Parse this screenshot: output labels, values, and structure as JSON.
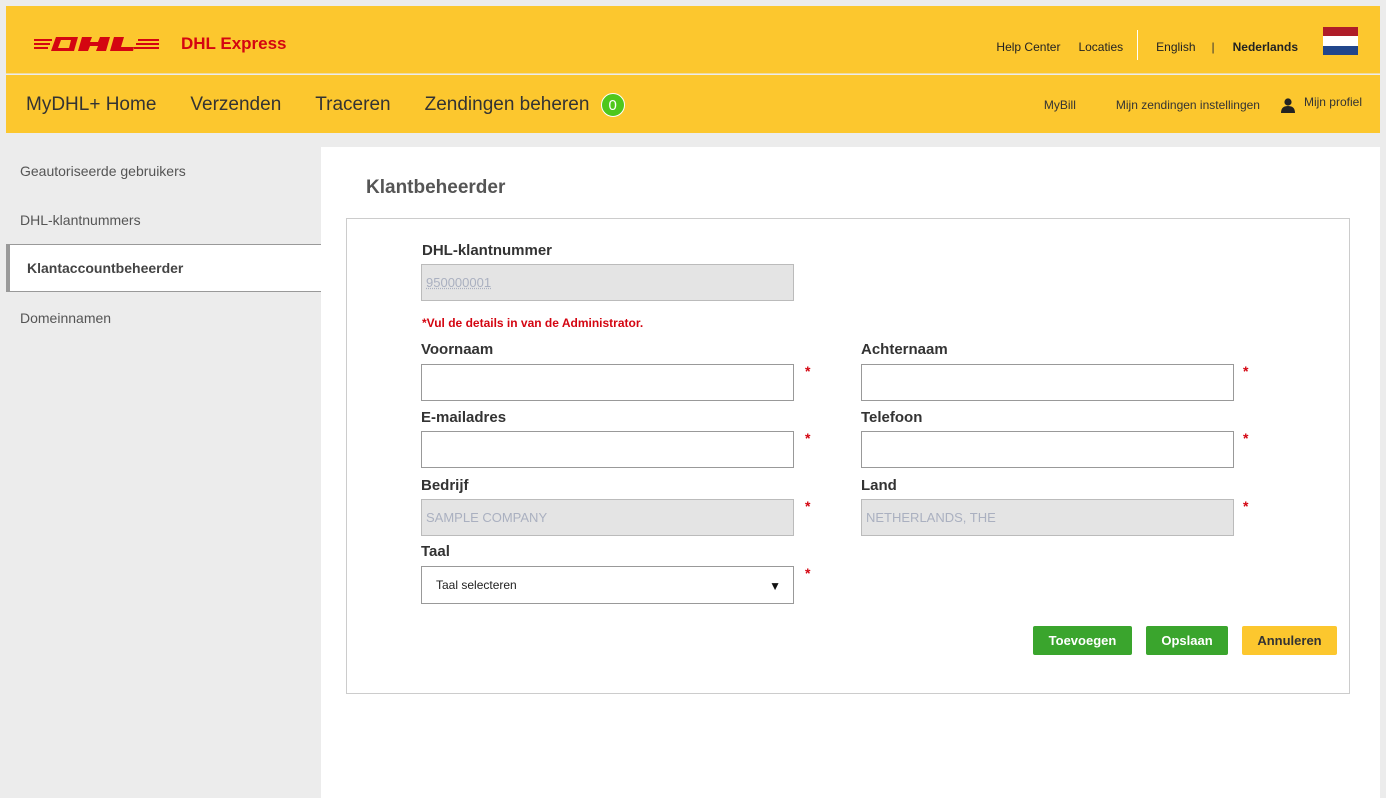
{
  "brand": {
    "logo_text": "DHL Express",
    "colors": {
      "red": "#d40511",
      "yellow": "#fcc72e",
      "green": "#3aa52d"
    }
  },
  "top_links": {
    "help_center": "Help Center",
    "locaties": "Locaties",
    "english": "English",
    "separator": "|",
    "nederlands": "Nederlands",
    "flag_icon": "netherlands-flag-icon"
  },
  "nav": {
    "home": "MyDHL+ Home",
    "verzenden": "Verzenden",
    "traceren": "Traceren",
    "zendingen_beheren": "Zendingen beheren",
    "badge_count": "0",
    "mybill": "MyBill",
    "settings": "Mijn zendingen instellingen",
    "profile": "Mijn profiel",
    "profile_icon": "person-icon"
  },
  "sidebar": {
    "items": [
      {
        "label": "Geautoriseerde gebruikers"
      },
      {
        "label": "DHL-klantnummers"
      },
      {
        "label": "Klantaccountbeheerder"
      },
      {
        "label": "Domeinnamen"
      }
    ],
    "active_index": 2
  },
  "main": {
    "title": "Klantbeheerder",
    "form": {
      "account_label": "DHL-klantnummer",
      "account_value": "950000001",
      "warning": "*Vul de details in van de Administrator.",
      "first_name_label": "Voornaam",
      "last_name_label": "Achternaam",
      "email_label": "E-mailadres",
      "phone_label": "Telefoon",
      "company_label": "Bedrijf",
      "company_value": "SAMPLE COMPANY",
      "country_label": "Land",
      "country_value": "NETHERLANDS, THE",
      "language_label": "Taal",
      "language_value": "Taal selecteren",
      "required_mark": "*"
    },
    "buttons": {
      "add": "Toevoegen",
      "save": "Opslaan",
      "cancel": "Annuleren"
    }
  }
}
